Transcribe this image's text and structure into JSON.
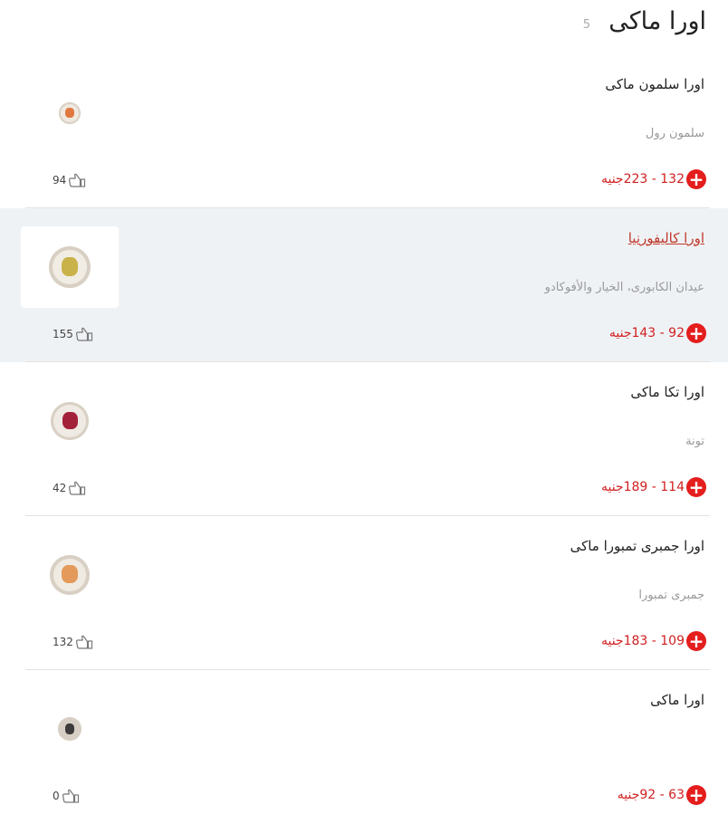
{
  "section": {
    "title": "اورا ماكى",
    "count": "5"
  },
  "currency": "جنيه",
  "items": [
    {
      "name": "اورا سلمون ماكى",
      "description": "سلمون رول",
      "price": "132 - 223جنيه",
      "likes": "94",
      "active": false,
      "roll": {
        "size": 24,
        "outer": "#efe9e0",
        "inner": "#e07840"
      }
    },
    {
      "name": "اورا كاليفورنيا",
      "description": "عيدان الكابورى، الخيار والأفوكادو",
      "price": "92 - 143جنيه",
      "likes": "155",
      "active": true,
      "roll": {
        "size": 46,
        "outer": "#f1ede4",
        "inner": "#c9b24a"
      }
    },
    {
      "name": "اورا تكا ماكى",
      "description": "تونة",
      "price": "114 - 189جنيه",
      "likes": "42",
      "active": false,
      "roll": {
        "size": 42,
        "outer": "#efeae3",
        "inner": "#a3223a"
      }
    },
    {
      "name": "اورا جمبرى تمبورا ماكى",
      "description": "جمبرى تمبورا",
      "price": "109 - 183جنيه",
      "likes": "132",
      "active": false,
      "roll": {
        "size": 44,
        "outer": "#f0ebe2",
        "inner": "#e39a5a"
      }
    },
    {
      "name": "اورا ماكى",
      "description": "",
      "price": "63 - 92جنيه",
      "likes": "0",
      "active": false,
      "roll": {
        "size": 26,
        "outer": "#d7cfc5",
        "inner": "#3c3a3a"
      }
    }
  ]
}
